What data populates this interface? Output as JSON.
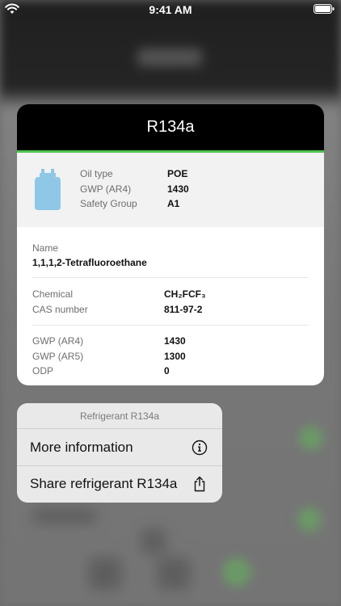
{
  "status_bar": {
    "time": "9:41 AM"
  },
  "card": {
    "title": "R134a",
    "summary": {
      "labels": [
        "Oil type",
        "GWP (AR4)",
        "Safety Group"
      ],
      "values": [
        "POE",
        "1430",
        "A1"
      ]
    },
    "name": {
      "label": "Name",
      "value": "1,1,1,2-Tetrafluoroethane"
    },
    "chemical": {
      "label": "Chemical",
      "value": "CH₂FCF₃"
    },
    "cas": {
      "label": "CAS number",
      "value": "811-97-2"
    },
    "gwp_ar4": {
      "label": "GWP (AR4)",
      "value": "1430"
    },
    "gwp_ar5": {
      "label": "GWP (AR5)",
      "value": "1300"
    },
    "odp": {
      "label": "ODP",
      "value": "0"
    }
  },
  "menu": {
    "title": "Refrigerant R134a",
    "items": [
      {
        "label": "More information",
        "icon": "info-circle-icon"
      },
      {
        "label": "Share refrigerant R134a",
        "icon": "share-icon"
      }
    ]
  },
  "colors": {
    "accent": "#4cc34f",
    "cylinder": "#8fc7e6"
  }
}
